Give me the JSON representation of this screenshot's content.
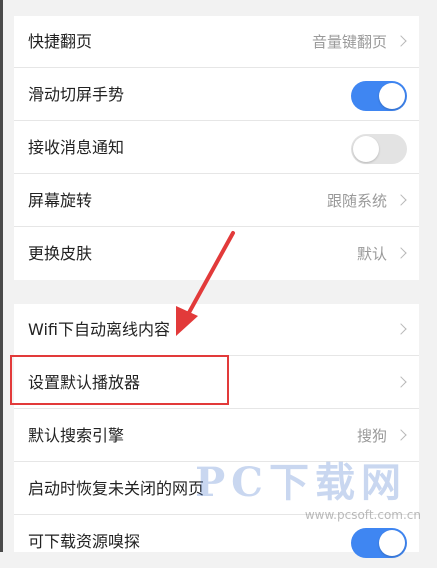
{
  "settings_group1": [
    {
      "label": "快捷翻页",
      "value": "音量键翻页",
      "control": "chevron"
    },
    {
      "label": "滑动切屏手势",
      "control": "toggle",
      "state": "on"
    },
    {
      "label": "接收消息通知",
      "control": "toggle",
      "state": "off"
    },
    {
      "label": "屏幕旋转",
      "value": "跟随系统",
      "control": "chevron"
    },
    {
      "label": "更换皮肤",
      "value": "默认",
      "control": "chevron"
    }
  ],
  "settings_group2": [
    {
      "label": "Wifi下自动离线内容",
      "value": "",
      "control": "chevron"
    },
    {
      "label": "设置默认播放器",
      "value": "",
      "control": "chevron"
    },
    {
      "label": "默认搜索引擎",
      "value": "搜狗",
      "control": "chevron"
    },
    {
      "label": "启动时恢复未关闭的网页",
      "value": "",
      "control": "none"
    },
    {
      "label": "可下载资源嗅探",
      "control": "toggle",
      "state": "on"
    }
  ],
  "watermark": {
    "text": "PC下载网",
    "sub": "www.pcsoft.com.cn"
  },
  "colors": {
    "accent": "#3f86f2",
    "annotation": "#e23a3a"
  }
}
